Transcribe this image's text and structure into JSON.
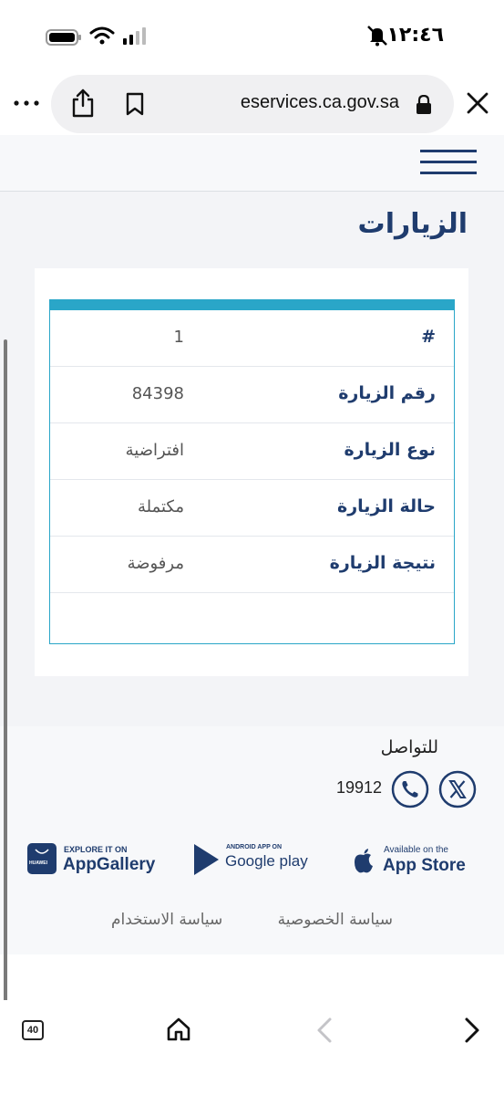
{
  "status_bar": {
    "time": "١٢:٤٦"
  },
  "browser": {
    "url": "eservices.ca.gov.sa",
    "tab_count": "40"
  },
  "page": {
    "title": "الزيارات"
  },
  "visit_table": {
    "rows": [
      {
        "label": "#",
        "value": "1"
      },
      {
        "label": "رقم الزيارة",
        "value": "84398"
      },
      {
        "label": "نوع الزيارة",
        "value": "افتراضية"
      },
      {
        "label": "حالة الزيارة",
        "value": "مكتملة"
      },
      {
        "label": "نتيجة الزيارة",
        "value": "مرفوضة"
      }
    ]
  },
  "footer": {
    "contact_title": "للتواصل",
    "phone": "19912",
    "stores": {
      "appstore": {
        "small": "Available on the",
        "big": "App Store"
      },
      "googleplay": {
        "small": "ANDROID APP ON",
        "big": "Google play"
      },
      "appgallery": {
        "small": "EXPLORE IT ON",
        "big": "AppGallery",
        "brand": "HUAWEI"
      }
    },
    "links": {
      "privacy": "سياسة الخصوصية",
      "terms": "سياسة الاستخدام"
    }
  },
  "colors": {
    "accent": "#2aa6c8",
    "navy": "#1f3c6e",
    "background": "#f3f4f7"
  }
}
